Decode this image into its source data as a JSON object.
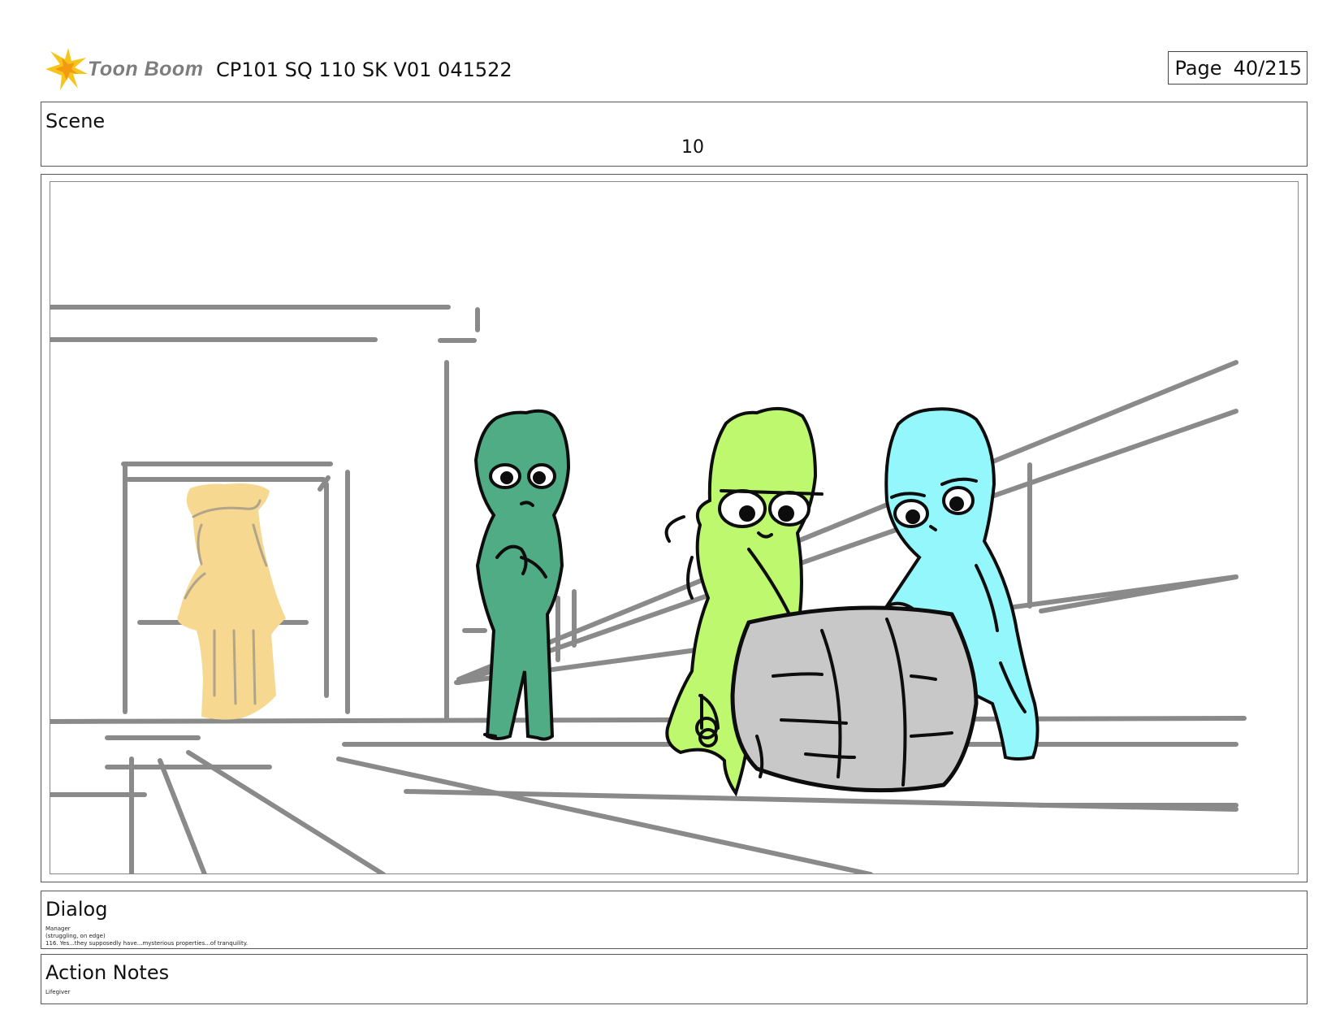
{
  "header": {
    "logo_text": "Toon Boom",
    "project_title": "CP101 SQ 110 SK V01 041522",
    "page_label": "Page",
    "page_number": "40/215"
  },
  "scene": {
    "label": "Scene",
    "number": "10"
  },
  "dialog": {
    "label": "Dialog",
    "character": "Manager",
    "parenthetical": "(struggling, on edge)",
    "line": "116. Yes...they supposedly have...mysterious properties...of tranquility."
  },
  "action_notes": {
    "label": "Action Notes",
    "text": "Lifegiver"
  },
  "colors": {
    "character_yellow": "#f6d890",
    "character_dark_green": "#4fac84",
    "character_lime": "#bdf86e",
    "character_cyan": "#93f7fb",
    "barrel_gray": "#c8c8c8",
    "background_lines": "#8a8a8a",
    "logo_star": "#f7c51a"
  }
}
